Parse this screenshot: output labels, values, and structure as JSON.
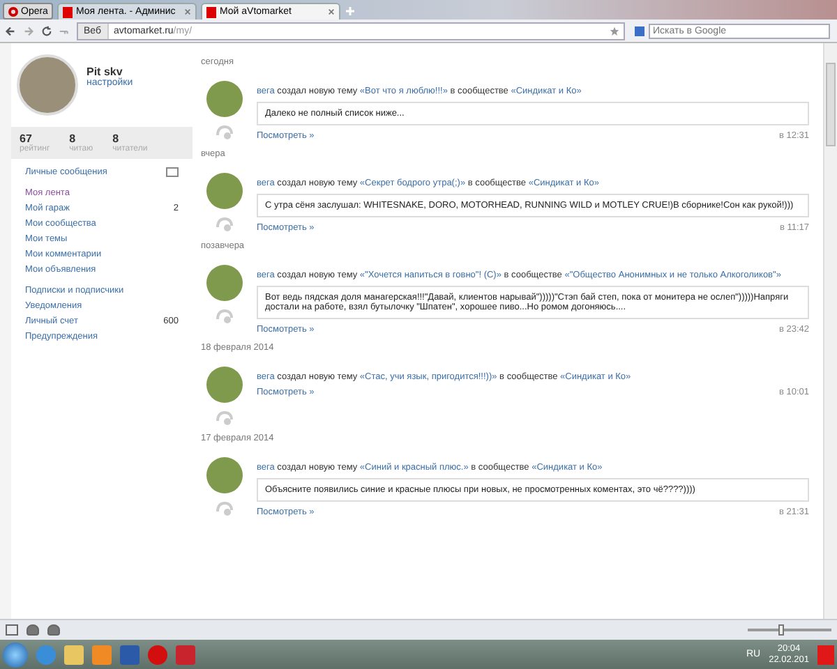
{
  "browser": {
    "menu_button": "Opera",
    "tabs": [
      {
        "title": "Моя лента. - Админис",
        "selected": false
      },
      {
        "title": "Мой aVtomarket",
        "selected": true
      }
    ],
    "address_label": "Веб",
    "address": "avtomarket.ru",
    "address_path": "/my/",
    "search": {
      "placeholder": "Искать в Google"
    }
  },
  "profile": {
    "name": "Pit skv",
    "settings_link": "настройки",
    "stats": [
      {
        "value": "67",
        "label": "рейтинг"
      },
      {
        "value": "8",
        "label": "читаю"
      },
      {
        "value": "8",
        "label": "читатели"
      }
    ]
  },
  "sidebar": {
    "groups": [
      [
        {
          "label": "Личные сообщения",
          "kind": "mail",
          "selected": false
        }
      ],
      [
        {
          "label": "Моя лента",
          "selected": true
        },
        {
          "label": "Мой гараж",
          "count": "2",
          "selected": false
        },
        {
          "label": "Мои сообщества",
          "selected": false
        },
        {
          "label": "Мои темы",
          "selected": false
        },
        {
          "label": "Мои комментарии",
          "selected": false
        },
        {
          "label": "Мои объявления",
          "selected": false
        }
      ],
      [
        {
          "label": "Подписки и подписчики",
          "selected": false
        },
        {
          "label": "Уведомления",
          "selected": false
        },
        {
          "label": "Личный счет",
          "count": "600",
          "selected": false
        },
        {
          "label": "Предупреждения",
          "selected": false
        }
      ]
    ]
  },
  "feed": [
    {
      "date": "сегодня",
      "posts": [
        {
          "author": "вега",
          "action": "создал новую тему",
          "topic": "«Вот что я люблю!!!»",
          "preposition": "в сообществе",
          "community": "«Синдикат и Ко»",
          "quote": "Далеко не полный список ниже...",
          "view_link": "Посмотреть »",
          "time": "в 12:31"
        }
      ]
    },
    {
      "date": "вчера",
      "posts": [
        {
          "author": "вега",
          "action": "создал новую тему",
          "topic": "«Секрет бодрого утра(;)»",
          "preposition": "в сообществе",
          "community": "«Синдикат и Ко»",
          "quote": "С утра сёня заслушал: WHITESNAKE, DORO, MOTORHEAD, RUNNING WILD и MOTLEY CRUE!)В сборнике!Сон как рукой!)))",
          "view_link": "Посмотреть »",
          "time": "в 11:17"
        }
      ]
    },
    {
      "date": "позавчера",
      "posts": [
        {
          "author": "вега",
          "action": "создал новую тему",
          "topic": "«\"Хочется напиться в говно\"! (С)»",
          "preposition": "в сообществе",
          "community": "«\"Общество Анонимных и не только Алкоголиков\"»",
          "quote": "Вот ведь пядская доля манагерская!!!\"Давай, клиентов нарывай\")))))\"Стэп бай степ, пока от монитера не ослеп\")))))Напряги достали на работе, взял бутылочку \"Шпатен\", хорошее пиво...Но ромом догоняюсь....",
          "view_link": "Посмотреть »",
          "time": "в 23:42"
        }
      ]
    },
    {
      "date": "18 февраля 2014",
      "posts": [
        {
          "author": "вега",
          "action": "создал новую тему",
          "topic": "«Стас, учи язык, пригодится!!!))»",
          "preposition": "в сообществе",
          "community": "«Синдикат и Ко»",
          "view_link": "Посмотреть »",
          "time": "в 10:01"
        }
      ]
    },
    {
      "date": "17 февраля 2014",
      "posts": [
        {
          "author": "вега",
          "action": "создал новую тему",
          "topic": "«Синий и красный плюс.»",
          "preposition": "в сообществе",
          "community": "«Синдикат и Ко»",
          "quote": "Объясните появились синие и красные плюсы при новых, не просмотренных коментах, это чё????))))",
          "view_link": "Посмотреть »",
          "time": "в 21:31"
        }
      ]
    }
  ],
  "status_bar": {
    "zoom": {
      "level": 0.4
    }
  },
  "taskbar": {
    "language": "RU",
    "time": "20:04",
    "date": "22.02.201"
  }
}
